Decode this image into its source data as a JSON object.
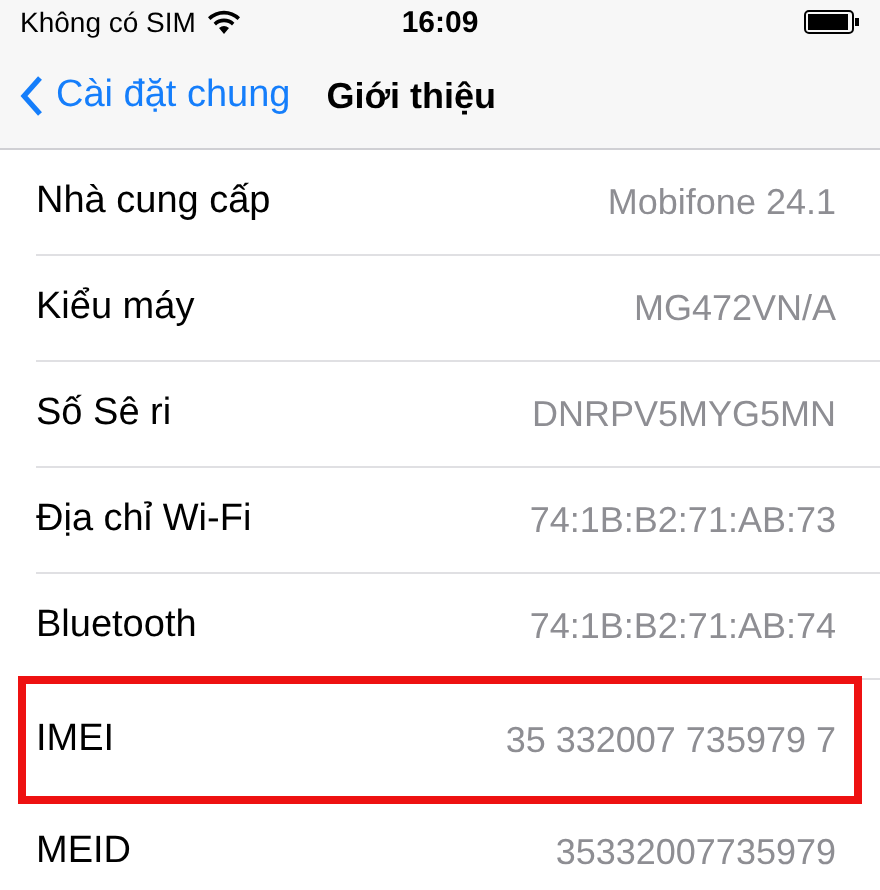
{
  "status_bar": {
    "carrier": "Không có SIM",
    "time": "16:09"
  },
  "nav": {
    "back": "Cài đặt chung",
    "title": "Giới thiệu"
  },
  "rows": [
    {
      "label": "Nhà cung cấp",
      "value": "Mobifone 24.1",
      "highlighted": false
    },
    {
      "label": "Kiểu máy",
      "value": "MG472VN/A",
      "highlighted": false
    },
    {
      "label": "Số Sê ri",
      "value": "DNRPV5MYG5MN",
      "highlighted": false
    },
    {
      "label": "Địa chỉ Wi-Fi",
      "value": "74:1B:B2:71:AB:73",
      "highlighted": false
    },
    {
      "label": "Bluetooth",
      "value": "74:1B:B2:71:AB:74",
      "highlighted": false
    },
    {
      "label": "IMEI",
      "value": "35 332007 735979 7",
      "highlighted": true
    },
    {
      "label": "MEID",
      "value": "35332007735979",
      "highlighted": false
    }
  ]
}
